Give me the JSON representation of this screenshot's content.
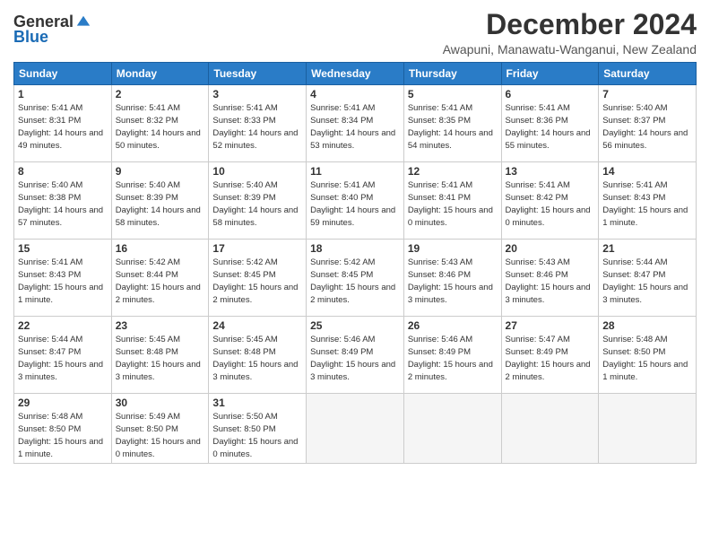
{
  "logo": {
    "general": "General",
    "blue": "Blue"
  },
  "header": {
    "month": "December 2024",
    "location": "Awapuni, Manawatu-Wanganui, New Zealand"
  },
  "weekdays": [
    "Sunday",
    "Monday",
    "Tuesday",
    "Wednesday",
    "Thursday",
    "Friday",
    "Saturday"
  ],
  "weeks": [
    [
      {
        "day": "1",
        "sunrise": "5:41 AM",
        "sunset": "8:31 PM",
        "daylight": "14 hours and 49 minutes."
      },
      {
        "day": "2",
        "sunrise": "5:41 AM",
        "sunset": "8:32 PM",
        "daylight": "14 hours and 50 minutes."
      },
      {
        "day": "3",
        "sunrise": "5:41 AM",
        "sunset": "8:33 PM",
        "daylight": "14 hours and 52 minutes."
      },
      {
        "day": "4",
        "sunrise": "5:41 AM",
        "sunset": "8:34 PM",
        "daylight": "14 hours and 53 minutes."
      },
      {
        "day": "5",
        "sunrise": "5:41 AM",
        "sunset": "8:35 PM",
        "daylight": "14 hours and 54 minutes."
      },
      {
        "day": "6",
        "sunrise": "5:41 AM",
        "sunset": "8:36 PM",
        "daylight": "14 hours and 55 minutes."
      },
      {
        "day": "7",
        "sunrise": "5:40 AM",
        "sunset": "8:37 PM",
        "daylight": "14 hours and 56 minutes."
      }
    ],
    [
      {
        "day": "8",
        "sunrise": "5:40 AM",
        "sunset": "8:38 PM",
        "daylight": "14 hours and 57 minutes."
      },
      {
        "day": "9",
        "sunrise": "5:40 AM",
        "sunset": "8:39 PM",
        "daylight": "14 hours and 58 minutes."
      },
      {
        "day": "10",
        "sunrise": "5:40 AM",
        "sunset": "8:39 PM",
        "daylight": "14 hours and 58 minutes."
      },
      {
        "day": "11",
        "sunrise": "5:41 AM",
        "sunset": "8:40 PM",
        "daylight": "14 hours and 59 minutes."
      },
      {
        "day": "12",
        "sunrise": "5:41 AM",
        "sunset": "8:41 PM",
        "daylight": "15 hours and 0 minutes."
      },
      {
        "day": "13",
        "sunrise": "5:41 AM",
        "sunset": "8:42 PM",
        "daylight": "15 hours and 0 minutes."
      },
      {
        "day": "14",
        "sunrise": "5:41 AM",
        "sunset": "8:43 PM",
        "daylight": "15 hours and 1 minute."
      }
    ],
    [
      {
        "day": "15",
        "sunrise": "5:41 AM",
        "sunset": "8:43 PM",
        "daylight": "15 hours and 1 minute."
      },
      {
        "day": "16",
        "sunrise": "5:42 AM",
        "sunset": "8:44 PM",
        "daylight": "15 hours and 2 minutes."
      },
      {
        "day": "17",
        "sunrise": "5:42 AM",
        "sunset": "8:45 PM",
        "daylight": "15 hours and 2 minutes."
      },
      {
        "day": "18",
        "sunrise": "5:42 AM",
        "sunset": "8:45 PM",
        "daylight": "15 hours and 2 minutes."
      },
      {
        "day": "19",
        "sunrise": "5:43 AM",
        "sunset": "8:46 PM",
        "daylight": "15 hours and 3 minutes."
      },
      {
        "day": "20",
        "sunrise": "5:43 AM",
        "sunset": "8:46 PM",
        "daylight": "15 hours and 3 minutes."
      },
      {
        "day": "21",
        "sunrise": "5:44 AM",
        "sunset": "8:47 PM",
        "daylight": "15 hours and 3 minutes."
      }
    ],
    [
      {
        "day": "22",
        "sunrise": "5:44 AM",
        "sunset": "8:47 PM",
        "daylight": "15 hours and 3 minutes."
      },
      {
        "day": "23",
        "sunrise": "5:45 AM",
        "sunset": "8:48 PM",
        "daylight": "15 hours and 3 minutes."
      },
      {
        "day": "24",
        "sunrise": "5:45 AM",
        "sunset": "8:48 PM",
        "daylight": "15 hours and 3 minutes."
      },
      {
        "day": "25",
        "sunrise": "5:46 AM",
        "sunset": "8:49 PM",
        "daylight": "15 hours and 3 minutes."
      },
      {
        "day": "26",
        "sunrise": "5:46 AM",
        "sunset": "8:49 PM",
        "daylight": "15 hours and 2 minutes."
      },
      {
        "day": "27",
        "sunrise": "5:47 AM",
        "sunset": "8:49 PM",
        "daylight": "15 hours and 2 minutes."
      },
      {
        "day": "28",
        "sunrise": "5:48 AM",
        "sunset": "8:50 PM",
        "daylight": "15 hours and 1 minute."
      }
    ],
    [
      {
        "day": "29",
        "sunrise": "5:48 AM",
        "sunset": "8:50 PM",
        "daylight": "15 hours and 1 minute."
      },
      {
        "day": "30",
        "sunrise": "5:49 AM",
        "sunset": "8:50 PM",
        "daylight": "15 hours and 0 minutes."
      },
      {
        "day": "31",
        "sunrise": "5:50 AM",
        "sunset": "8:50 PM",
        "daylight": "15 hours and 0 minutes."
      },
      null,
      null,
      null,
      null
    ]
  ]
}
